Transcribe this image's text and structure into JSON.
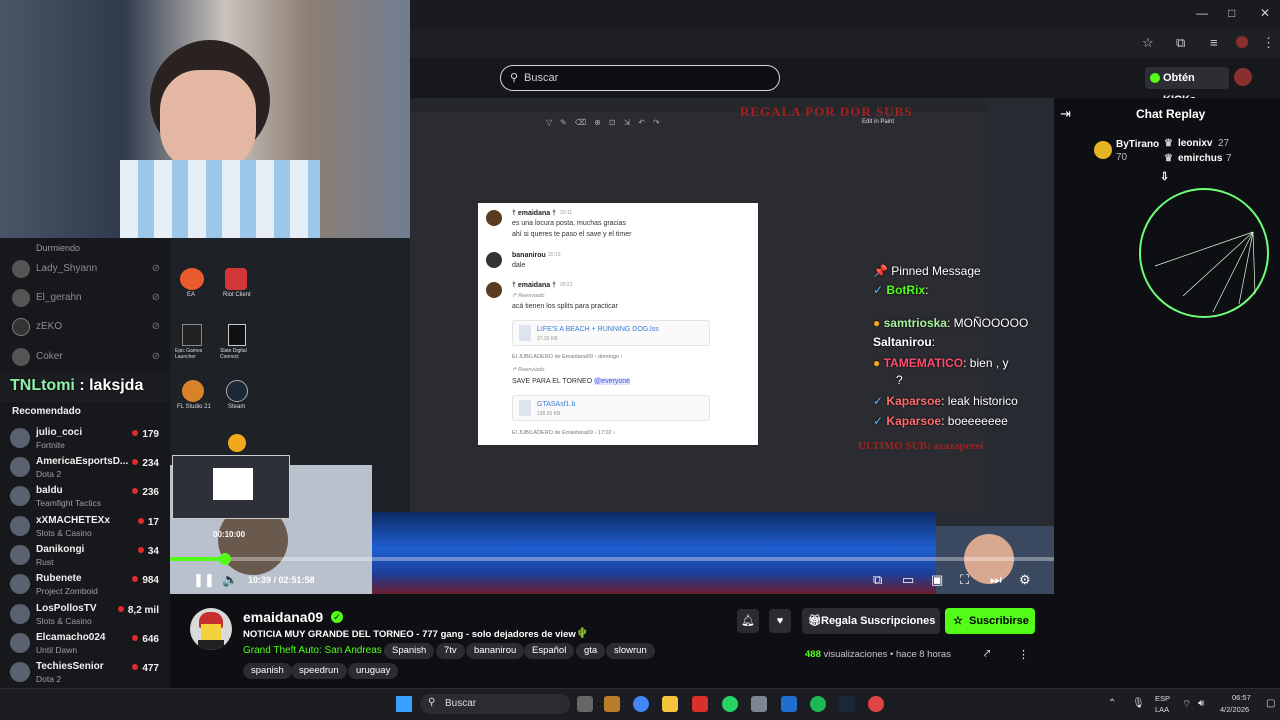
{
  "browser": {
    "minimize": "—",
    "maximize": "□",
    "close": "✕"
  },
  "header": {
    "search_placeholder": "Buscar",
    "kicks_label": "Obtén KICKs"
  },
  "sidebar": {
    "following": [
      {
        "name": "Durmiendo",
        "sub": true
      },
      {
        "name": "Lady_Shyann"
      },
      {
        "name": "El_gerahn"
      },
      {
        "name": "zEKO"
      },
      {
        "name": "Coker"
      }
    ],
    "recomendado_label": "Recomendado",
    "recommended": [
      {
        "name": "julio_coci",
        "category": "Fortnite",
        "viewers": "179"
      },
      {
        "name": "AmericaEsportsD...",
        "category": "Dota 2",
        "viewers": "234"
      },
      {
        "name": "baldu",
        "category": "Teamfight Tactics",
        "viewers": "236"
      },
      {
        "name": "xXMACHETEXx",
        "category": "Slots & Casino",
        "viewers": "17"
      },
      {
        "name": "Danikongi",
        "category": "Rust",
        "viewers": "34"
      },
      {
        "name": "Rubenete",
        "category": "Project Zomboid",
        "viewers": "984"
      },
      {
        "name": "LosPollosTV",
        "category": "Slots & Casino",
        "viewers": "8,2 mil"
      },
      {
        "name": "Elcamacho024",
        "category": "Until Dawn",
        "viewers": "646"
      },
      {
        "name": "TechiesSenior",
        "category": "Dota 2",
        "viewers": "477"
      }
    ]
  },
  "overlay": {
    "tnl_name": "TNLtomi",
    "tnl_sep": " : ",
    "tnl_msg": "laksjda",
    "top_red_text": "REGALA POR DOR SUBS",
    "bottom_red_text": "ULTIMO SUB: azazaperei"
  },
  "desktop": {
    "edit_in_paint": "Edit in Paint",
    "icons": [
      {
        "label": "EA"
      },
      {
        "label": "Riot Client"
      },
      {
        "label": "Epic Games Launcher"
      },
      {
        "label": "Slate Digital Connect"
      },
      {
        "label": "FL Studio 21"
      },
      {
        "label": "Steam"
      }
    ]
  },
  "discord": {
    "m1_name": "† emaidana †",
    "m1_time": "20:11",
    "m1_line1": "es una locura posta, muchas gracias",
    "m1_line2": "ahí si queres te paso el save y el timer",
    "m2_name": "bananirou",
    "m2_time": "20:13",
    "m2_line1": "dale",
    "m3_name": "† emaidana †",
    "m3_time": "20:21",
    "m3_forward": "↱ Reenviado",
    "m3_line1": "acá tienen los splits para practicar",
    "file1_name": "LIFE'S A BEACH + RUNNING DOG.lss",
    "file1_size": "37.26 KB",
    "source1": "El JUBILADERO de Emaidana09 › domingo ›",
    "m4_forward": "↱ Reenviado",
    "m4_line1": "SAVE PARA EL TORNEO",
    "m4_mention": "@everyone",
    "file2_name": "GTASAsf1.b",
    "file2_size": "198.00 KB",
    "source2": "El JUBILADERO de Emaidana09 › 17:02 ›"
  },
  "pinned": {
    "title": "Pinned Message",
    "lines": [
      {
        "user": "BotRix",
        "text": ":"
      },
      {
        "user": "samtrioska",
        "text": ": MOÑOOOOO"
      },
      {
        "user": "Saltanirou",
        "text": ":"
      },
      {
        "user": "TAMEMATICO",
        "text": ": bien , y"
      },
      {
        "user": "",
        "text": "?"
      },
      {
        "user": "Kaparsoe",
        "text": ": leak historico"
      },
      {
        "user": "Kaparsoe",
        "text": ": boeeeeeee"
      }
    ]
  },
  "player": {
    "hover_time": "00:10:00",
    "time_current": "10:39",
    "time_sep": " / ",
    "time_total": "02:51:58",
    "progress_fraction": 0.062
  },
  "chat": {
    "title": "Chat Replay",
    "leaders": [
      {
        "name": "ByTirano",
        "count": "70"
      },
      {
        "name": "leonixv",
        "count": "27"
      },
      {
        "name": "emirchus",
        "count": "7"
      }
    ]
  },
  "channel": {
    "name": "emaidana09",
    "title": "NOTICIA MUY GRANDE DEL TORNEO - 777 gang - solo dejadores de view",
    "game": "Grand Theft Auto: San Andreas",
    "tags": [
      "Spanish",
      "7tv",
      "bananirou",
      "Español",
      "gta",
      "slowrun",
      "spanish",
      "speedrun",
      "uruguay"
    ],
    "gift_label": "Regala Suscripciones",
    "subscribe_label": "Suscribirse",
    "views_count": "488",
    "views_label": " visualizaciones",
    "ago": "hace 8 horas"
  },
  "taskbar": {
    "search_label": "Buscar",
    "lang_top": "ESP",
    "lang_bottom": "LAA",
    "time": "06:57",
    "date": "4/2/2026"
  },
  "colors": {
    "accent": "#53fc18",
    "red_overlay": "#a32020"
  }
}
